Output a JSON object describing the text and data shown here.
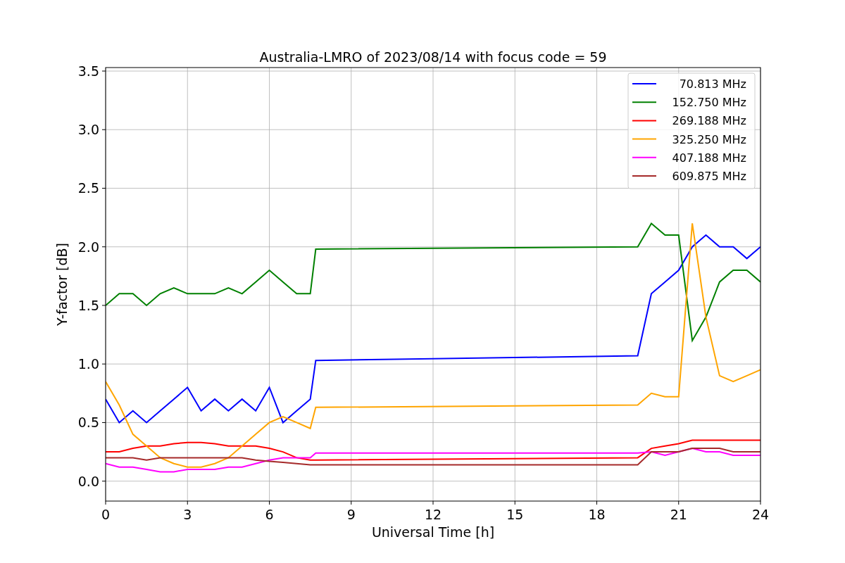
{
  "chart_data": {
    "type": "line",
    "title": "Australia-LMRO of 2023/08/14 with focus code = 59",
    "xlabel": "Universal Time [h]",
    "ylabel": "Y-factor [dB]",
    "x": [
      0,
      0.5,
      1,
      1.5,
      2,
      2.5,
      3,
      3.5,
      4,
      4.5,
      5,
      5.5,
      6,
      6.5,
      7,
      7.5,
      7.7,
      19.5,
      20,
      20.5,
      21,
      21.5,
      22,
      22.5,
      23,
      23.5,
      24
    ],
    "series": [
      {
        "name": "70.813 MHz",
        "color": "#0000ff",
        "values": [
          0.7,
          0.5,
          0.6,
          0.5,
          0.6,
          0.7,
          0.8,
          0.6,
          0.7,
          0.6,
          0.7,
          0.6,
          0.8,
          0.5,
          0.6,
          0.7,
          1.03,
          1.07,
          1.6,
          1.7,
          1.8,
          2.0,
          2.1,
          2.0,
          2.0,
          1.9,
          2.0
        ]
      },
      {
        "name": "152.750 MHz",
        "color": "#008000",
        "values": [
          1.5,
          1.6,
          1.6,
          1.5,
          1.6,
          1.65,
          1.6,
          1.6,
          1.6,
          1.65,
          1.6,
          1.7,
          1.8,
          1.7,
          1.6,
          1.6,
          1.98,
          2.0,
          2.2,
          2.1,
          2.1,
          1.2,
          1.4,
          1.7,
          1.8,
          1.8,
          1.7
        ]
      },
      {
        "name": "269.188 MHz",
        "color": "#ff0000",
        "values": [
          0.25,
          0.25,
          0.28,
          0.3,
          0.3,
          0.32,
          0.33,
          0.33,
          0.32,
          0.3,
          0.3,
          0.3,
          0.28,
          0.25,
          0.2,
          0.18,
          0.18,
          0.2,
          0.28,
          0.3,
          0.32,
          0.35,
          0.35,
          0.35,
          0.35,
          0.35,
          0.35
        ]
      },
      {
        "name": "325.250 MHz",
        "color": "#ffa500",
        "values": [
          0.85,
          0.65,
          0.4,
          0.3,
          0.2,
          0.15,
          0.12,
          0.12,
          0.15,
          0.2,
          0.3,
          0.4,
          0.5,
          0.55,
          0.5,
          0.45,
          0.63,
          0.65,
          0.75,
          0.72,
          0.72,
          2.2,
          1.4,
          0.9,
          0.85,
          0.9,
          0.95
        ]
      },
      {
        "name": "407.188 MHz",
        "color": "#ff00ff",
        "values": [
          0.15,
          0.12,
          0.12,
          0.1,
          0.08,
          0.08,
          0.1,
          0.1,
          0.1,
          0.12,
          0.12,
          0.15,
          0.18,
          0.2,
          0.2,
          0.2,
          0.24,
          0.24,
          0.25,
          0.22,
          0.25,
          0.28,
          0.25,
          0.25,
          0.22,
          0.22,
          0.22
        ]
      },
      {
        "name": "609.875 MHz",
        "color": "#a52a2a",
        "values": [
          0.2,
          0.2,
          0.2,
          0.18,
          0.2,
          0.2,
          0.2,
          0.2,
          0.2,
          0.2,
          0.2,
          0.18,
          0.17,
          0.16,
          0.15,
          0.14,
          0.14,
          0.14,
          0.25,
          0.25,
          0.25,
          0.28,
          0.28,
          0.28,
          0.25,
          0.25,
          0.25
        ]
      }
    ],
    "grid": true,
    "legend": true,
    "xlim": [
      0,
      24
    ],
    "ylim": [
      -0.17,
      3.53
    ],
    "xticks": [
      0,
      3,
      6,
      9,
      12,
      15,
      18,
      21,
      24
    ],
    "yticks": [
      {
        "value": 0,
        "label": "0.0"
      },
      {
        "value": 0.5,
        "label": "0.5"
      },
      {
        "value": 1,
        "label": "1.0"
      },
      {
        "value": 1.5,
        "label": "1.5"
      },
      {
        "value": 2,
        "label": "2.0"
      },
      {
        "value": 2.5,
        "label": "2.5"
      },
      {
        "value": 3,
        "label": "3.0"
      },
      {
        "value": 3.5,
        "label": "3.5"
      }
    ]
  }
}
